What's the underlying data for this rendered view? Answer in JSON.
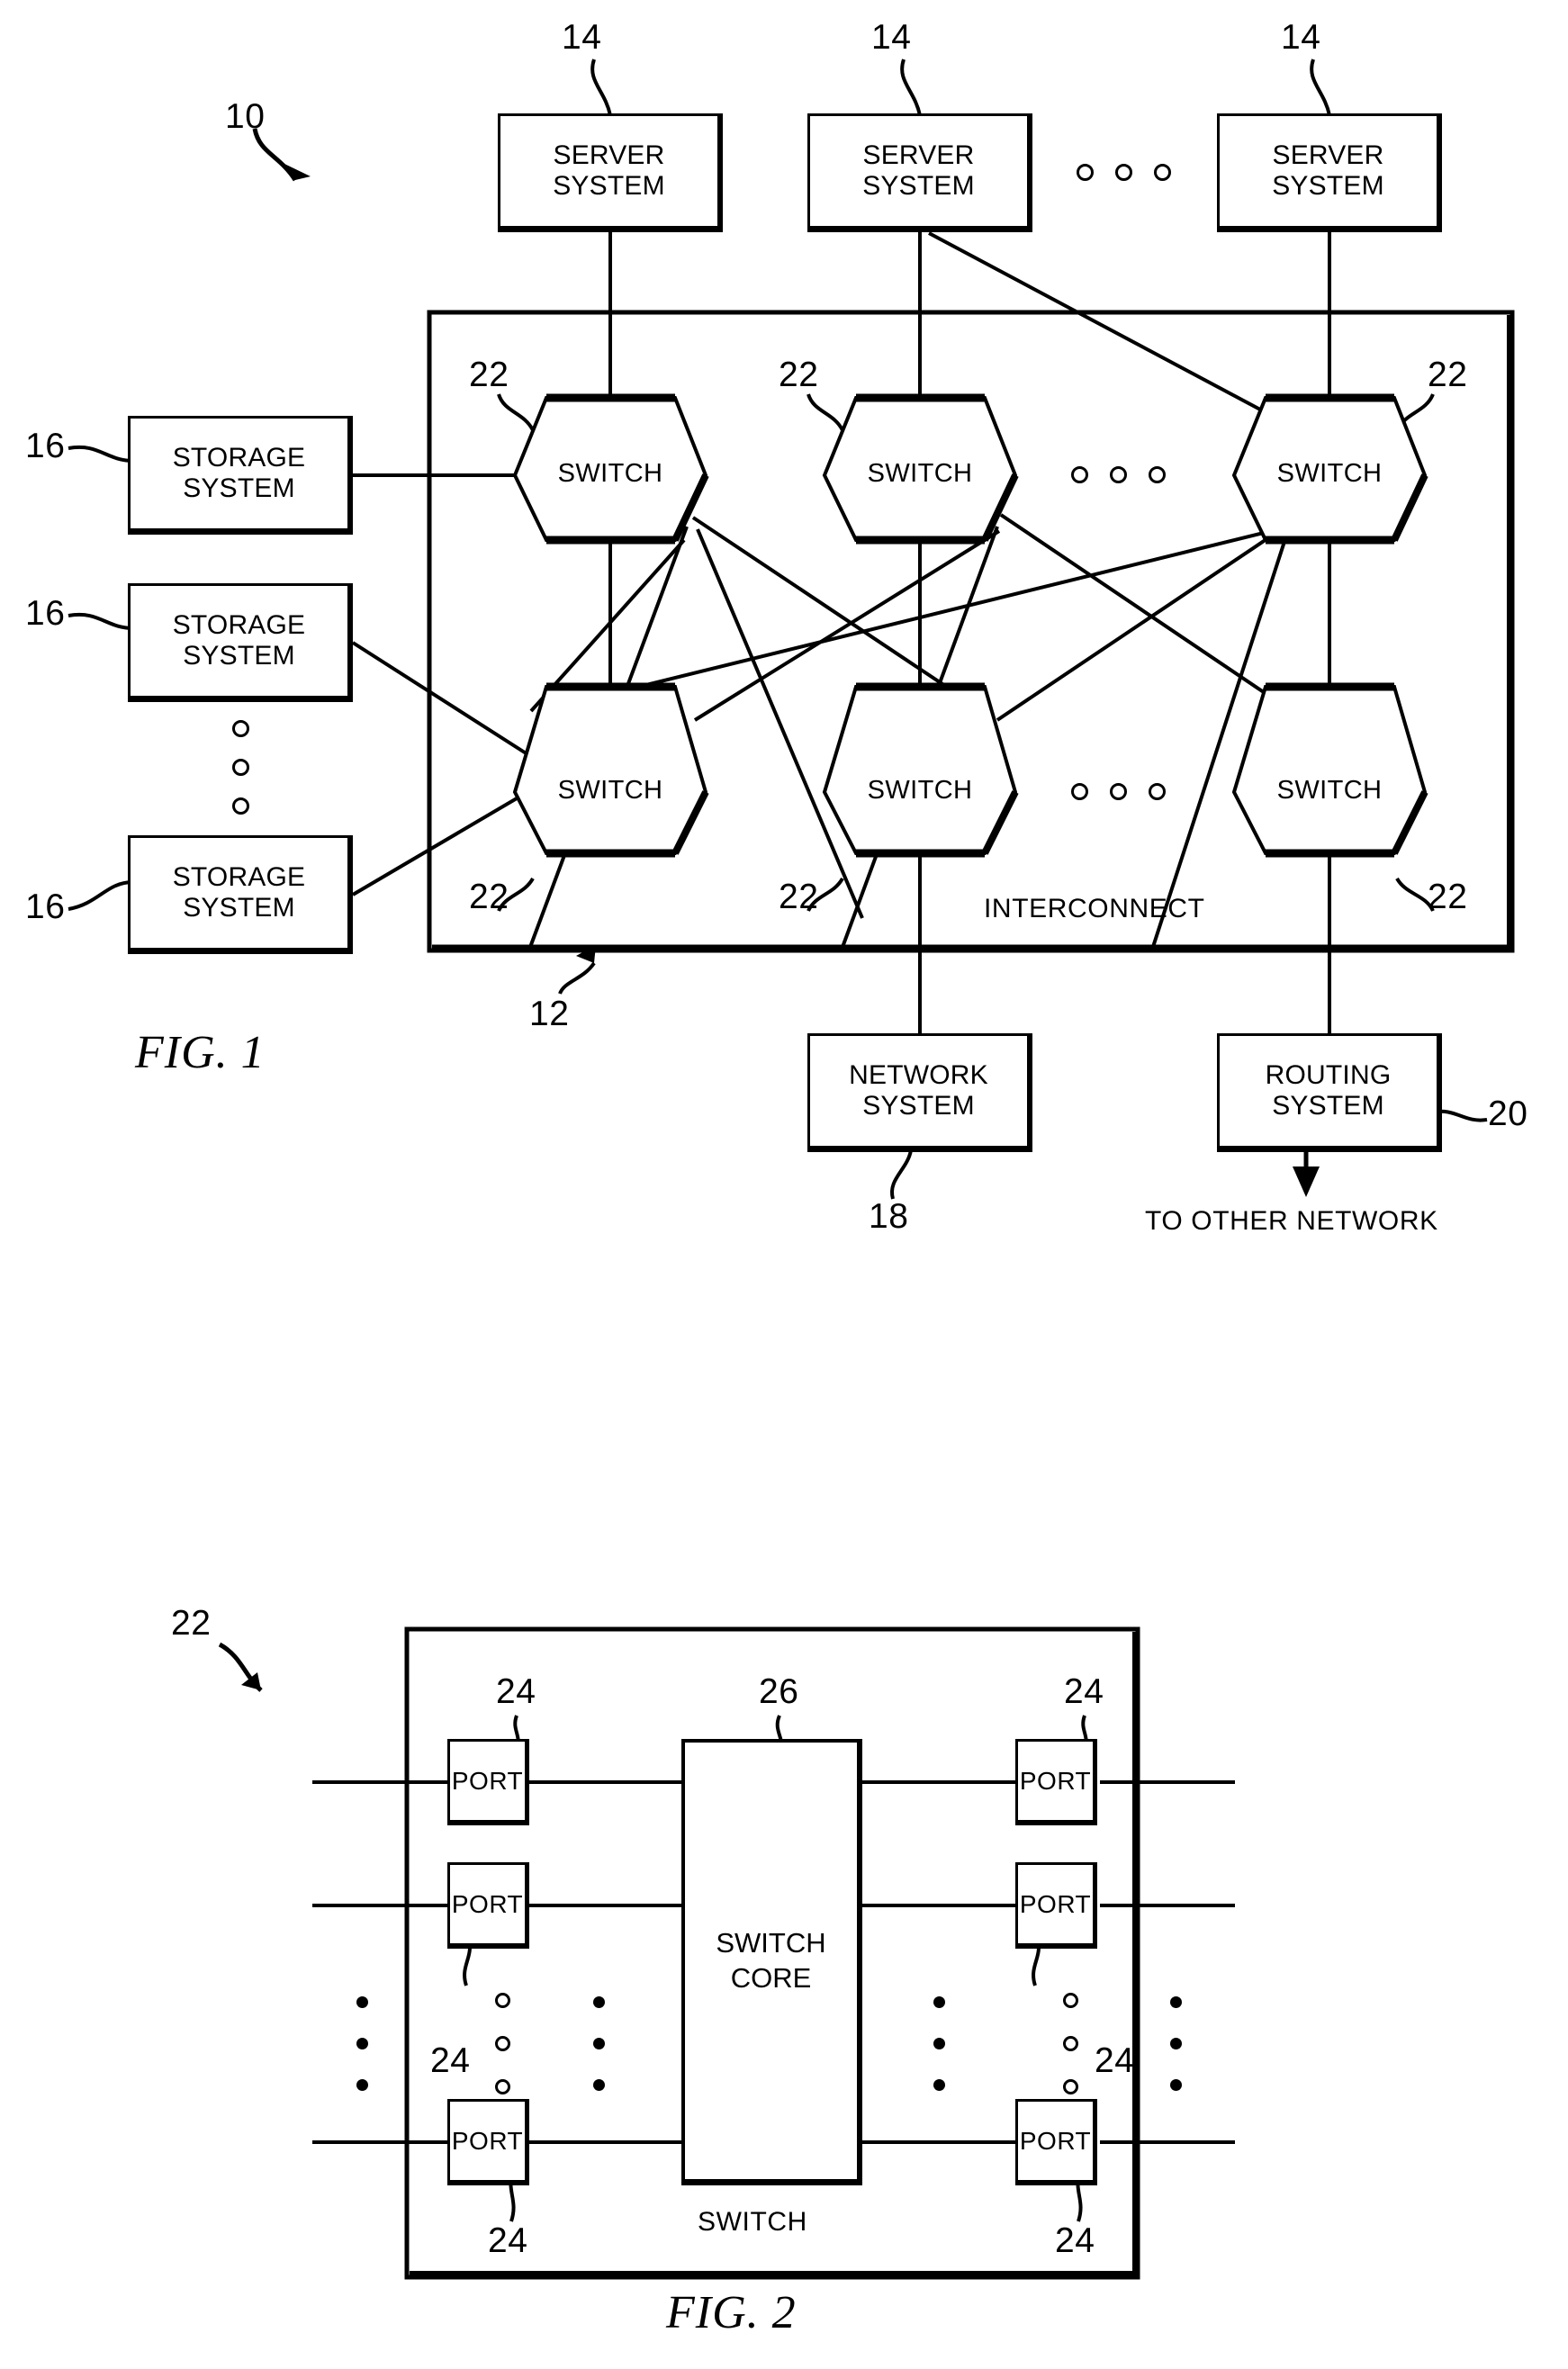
{
  "figures": [
    {
      "id": "fig1",
      "caption": "FIG. 1",
      "system_ref": "10",
      "interconnect": {
        "label": "INTERCONNECT",
        "ref": "12"
      },
      "servers": [
        {
          "line1": "SERVER",
          "line2": "SYSTEM",
          "ref": "14"
        },
        {
          "line1": "SERVER",
          "line2": "SYSTEM",
          "ref": "14"
        },
        {
          "line1": "SERVER",
          "line2": "SYSTEM",
          "ref": "14"
        }
      ],
      "storage": [
        {
          "line1": "STORAGE",
          "line2": "SYSTEM",
          "ref": "16"
        },
        {
          "line1": "STORAGE",
          "line2": "SYSTEM",
          "ref": "16"
        },
        {
          "line1": "STORAGE",
          "line2": "SYSTEM",
          "ref": "16"
        }
      ],
      "network_system": {
        "line1": "NETWORK",
        "line2": "SYSTEM",
        "ref": "18"
      },
      "routing_system": {
        "line1": "ROUTING",
        "line2": "SYSTEM",
        "ref": "20"
      },
      "routing_output": "TO OTHER NETWORK",
      "switches": [
        {
          "label": "SWITCH",
          "ref": "22"
        },
        {
          "label": "SWITCH",
          "ref": "22"
        },
        {
          "label": "SWITCH",
          "ref": "22"
        },
        {
          "label": "SWITCH",
          "ref": "22"
        },
        {
          "label": "SWITCH",
          "ref": "22"
        },
        {
          "label": "SWITCH",
          "ref": "22"
        }
      ]
    },
    {
      "id": "fig2",
      "caption": "FIG. 2",
      "switch_ref": "22",
      "switch_label": "SWITCH",
      "core": {
        "line1": "SWITCH",
        "line2": "CORE",
        "ref": "26"
      },
      "ports": [
        {
          "label": "PORT",
          "ref": "24"
        },
        {
          "label": "PORT",
          "ref": "24"
        },
        {
          "label": "PORT",
          "ref": "24"
        },
        {
          "label": "PORT",
          "ref": "24"
        },
        {
          "label": "PORT",
          "ref": "24"
        },
        {
          "label": "PORT",
          "ref": "24"
        }
      ]
    }
  ],
  "colors": {
    "ink": "#000000",
    "paper": "#ffffff"
  }
}
